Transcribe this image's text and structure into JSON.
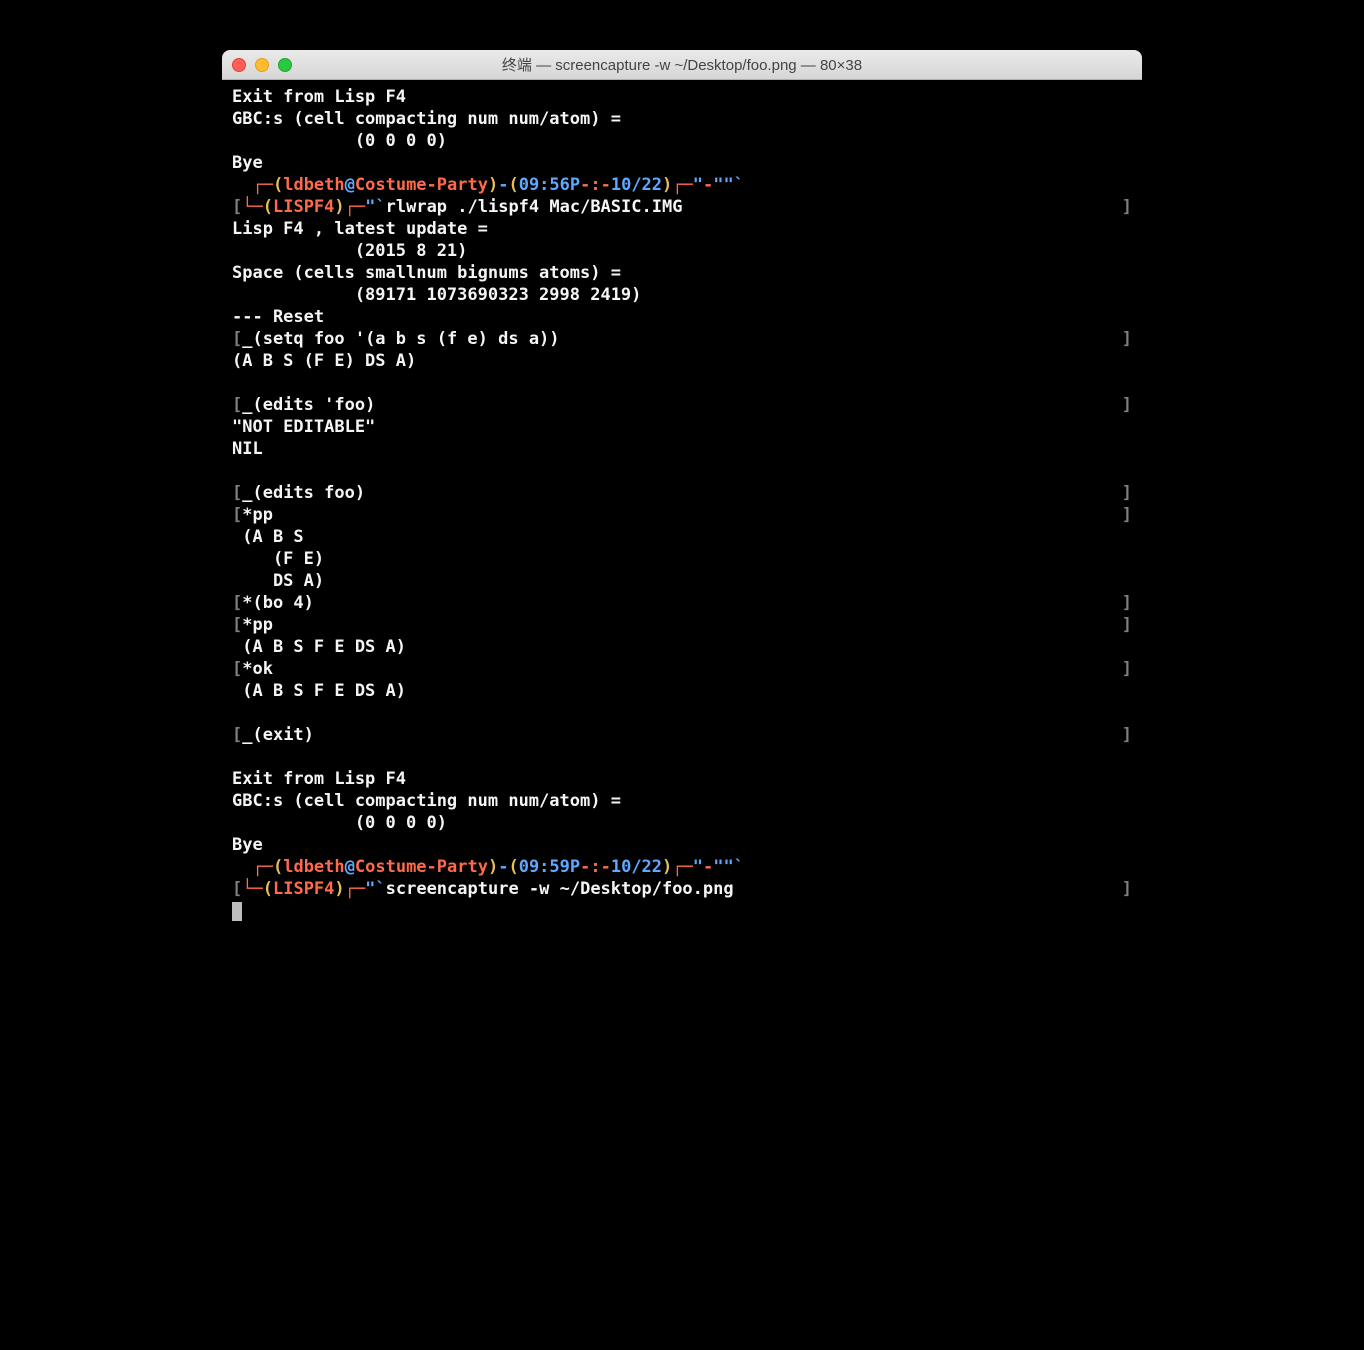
{
  "window": {
    "title": "终端 — screencapture -w ~/Desktop/foo.png — 80×38"
  },
  "prompt1": {
    "boxUL": "┌─",
    "lparen": "(",
    "user": "ldbeth",
    "at": "@",
    "host": "Costume-Party",
    "rparen": ")",
    "dash": "-",
    "lparen2": "(",
    "time": "09:56P",
    "sep": "-:-",
    "date": "10/22",
    "rparen2": ")",
    "right": "┌─",
    "q1": "\"",
    "dash2": "-",
    "q2": "\"\"",
    "tick": "`"
  },
  "prompt1b": {
    "lbracket": "[",
    "boxBL": "└─",
    "lparen": "(",
    "app": "LISPF4",
    "rparen": ")",
    "boxBL2": "┌─",
    "q": "\"`",
    "cmd": "rlwrap ./lispf4 Mac/BASIC.IMG",
    "rbracket": "]"
  },
  "prompt2": {
    "boxUL": "┌─",
    "lparen": "(",
    "user": "ldbeth",
    "at": "@",
    "host": "Costume-Party",
    "rparen": ")",
    "dash": "-",
    "lparen2": "(",
    "time": "09:59P",
    "sep": "-:-",
    "date": "10/22",
    "rparen2": ")",
    "right": "┌─",
    "q1": "\"",
    "dash2": "-",
    "q2": "\"\"",
    "tick": "`"
  },
  "prompt2b": {
    "lbracket": "[",
    "boxBL": "└─",
    "lparen": "(",
    "app": "LISPF4",
    "rparen": ")",
    "boxBL2": "┌─",
    "q": "\"`",
    "cmd": "screencapture -w ~/Desktop/foo.png",
    "rbracket": "]"
  },
  "lines": {
    "l01": "Exit from Lisp F4",
    "l02": "GBC:s (cell compacting num num/atom) =",
    "l03": "            (0 0 0 0)",
    "l04": "Bye",
    "l05": "Lisp F4 , latest update =",
    "l06": "            (2015 8 21)",
    "l07": "Space (cells smallnum bignums atoms) =",
    "l08": "            (89171 1073690323 2998 2419)",
    "l09": "--- Reset",
    "l10_lb": "[",
    "l10": "_(setq foo '(a b s (f e) ds a))",
    "l10_rb": "]",
    "l11": "(A B S (F E) DS A)",
    "l12": "",
    "l13_lb": "[",
    "l13": "_(edits 'foo)",
    "l13_rb": "]",
    "l14": "\"NOT EDITABLE\"",
    "l15": "NIL",
    "l16": "",
    "l17_lb": "[",
    "l17": "_(edits foo)",
    "l17_rb": "]",
    "l18_lb": "[",
    "l18": "*pp",
    "l18_rb": "]",
    "l19": " (A B S",
    "l20": "    (F E)",
    "l21": "    DS A)",
    "l22_lb": "[",
    "l22": "*(bo 4)",
    "l22_rb": "]",
    "l23_lb": "[",
    "l23": "*pp",
    "l23_rb": "]",
    "l24": " (A B S F E DS A)",
    "l25_lb": "[",
    "l25": "*ok",
    "l25_rb": "]",
    "l26": " (A B S F E DS A)",
    "l27": "",
    "l28_lb": "[",
    "l28": "_(exit)",
    "l28_rb": "]",
    "l29": "",
    "l30": "Exit from Lisp F4",
    "l31": "GBC:s (cell compacting num num/atom) =",
    "l32": "            (0 0 0 0)",
    "l33": "Bye"
  }
}
